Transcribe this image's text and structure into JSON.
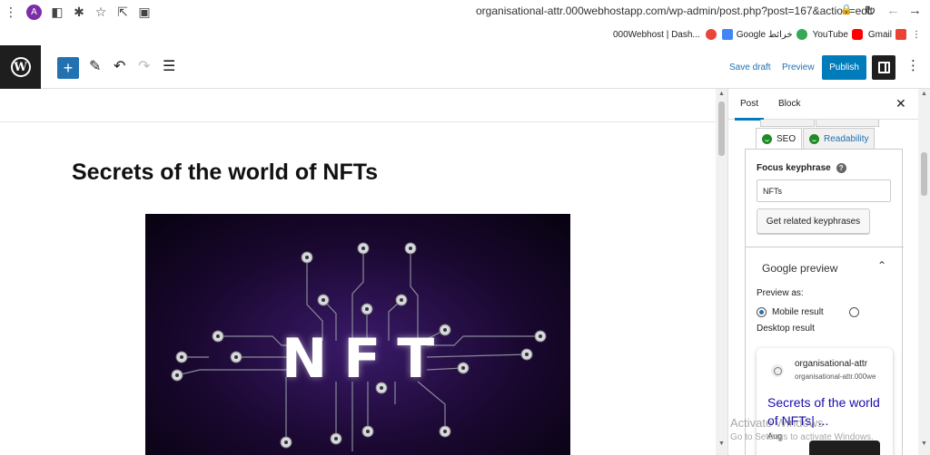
{
  "browser": {
    "profile_initial": "A",
    "url": "organisational-attr.000webhostapp.com/wp-admin/post.php?post=167&action=edit",
    "bookmarks": [
      {
        "label": "000Webhost | Dash...",
        "color": ""
      },
      {
        "label": "",
        "color": "#e8453c"
      },
      {
        "label": "Google خرائط",
        "color": "#4285f4"
      },
      {
        "label": "YouTube",
        "color": "#ff0000"
      },
      {
        "label": "Gmail",
        "color": "#ea4335"
      }
    ]
  },
  "toolbar": {
    "save_draft": "Save draft",
    "preview": "Preview",
    "publish": "Publish"
  },
  "editor": {
    "title": "Secrets of the world of NFTs",
    "image_text": "NFT"
  },
  "sidebar": {
    "tabs": [
      {
        "label": "Post"
      },
      {
        "label": "Block"
      }
    ],
    "yoast_tabs": {
      "seo": "SEO",
      "readability": "Readability"
    },
    "focus_keyphrase_label": "Focus keyphrase",
    "focus_keyphrase_value": "NFTs",
    "related_button": "Get related keyphrases",
    "google_preview_title": "Google preview",
    "preview_as_label": "Preview as:",
    "mobile_result": "Mobile result",
    "desktop_result": "Desktop result",
    "serp": {
      "site_name": "organisational-attr",
      "site_url": "organisational-attr.000we",
      "title": "Secrets of the world of NFTs| ...",
      "date": "Aug"
    }
  },
  "watermark": {
    "line1": "Activate Windows",
    "line2": "Go to Settings to activate Windows."
  },
  "colors": {
    "accent": "#007cba",
    "link": "#2271b1",
    "dark": "#1e1e1e",
    "yoast_green": "#1f8b24"
  }
}
